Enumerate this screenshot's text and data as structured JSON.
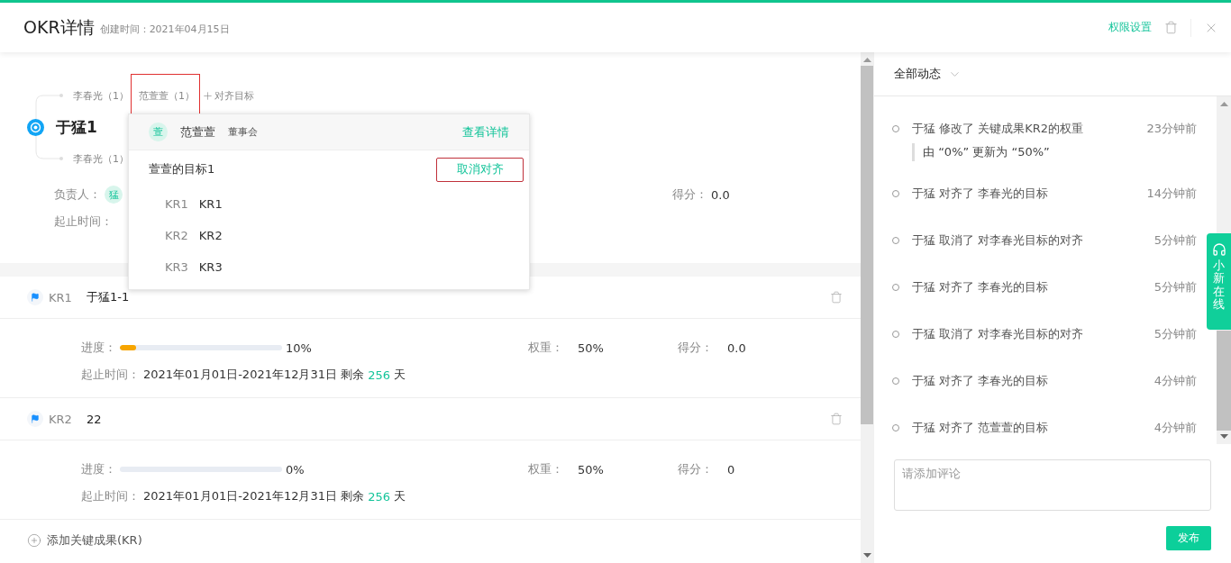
{
  "header": {
    "title": "OKR详情",
    "created": "创建时间：2021年04月15日",
    "permission_link": "权限设置"
  },
  "objective": {
    "title": "于猛1",
    "aligned_up": [
      {
        "label": "李春光（1）",
        "selected": false
      },
      {
        "label": "范萱萱（1）",
        "selected": true
      }
    ],
    "align_action": "对齐目标",
    "aligned_down": [
      {
        "label": "李春光（1）",
        "selected": false
      }
    ],
    "owner_label": "负责人：",
    "owner_avatar": "猛",
    "score_label": "得分：",
    "score": "0.0",
    "period_label": "起止时间："
  },
  "popover": {
    "avatar": "萱",
    "name": "范萱萱",
    "department": "董事会",
    "detail_link": "查看详情",
    "objective": "萱萱的目标1",
    "cancel_button": "取消对齐",
    "krs": [
      {
        "code": "KR1",
        "title": "KR1"
      },
      {
        "code": "KR2",
        "title": "KR2"
      },
      {
        "code": "KR3",
        "title": "KR3"
      }
    ]
  },
  "key_results": [
    {
      "code": "KR1",
      "title": "于猛1-1",
      "progress_label": "进度：",
      "level": 0.1,
      "progress": "10%",
      "weight_label": "权重：",
      "weight": "50%",
      "score_label": "得分：",
      "score": "0.0",
      "period_label": "起止时间：",
      "period": "2021年01月01日-2021年12月31日 剩余",
      "days": "256",
      "days_unit": "天"
    },
    {
      "code": "KR2",
      "title": "22",
      "progress_label": "进度：",
      "level": 0,
      "progress": "0%",
      "weight_label": "权重：",
      "weight": "50%",
      "score_label": "得分：",
      "score": "0",
      "period_label": "起止时间：",
      "period": "2021年01月01日-2021年12月31日 剩余",
      "days": "256",
      "days_unit": "天"
    }
  ],
  "add_kr": "添加关键成果(KR)",
  "activity": {
    "filter": "全部动态",
    "items": [
      {
        "text": "于猛 修改了 关键成果KR2的权重",
        "detail": "由 “0%” 更新为 “50%”",
        "time": "23分钟前"
      },
      {
        "text": "于猛 对齐了 李春光的目标",
        "time": "14分钟前"
      },
      {
        "text": "于猛 取消了 对李春光目标的对齐",
        "time": "5分钟前"
      },
      {
        "text": "于猛 对齐了 李春光的目标",
        "time": "5分钟前"
      },
      {
        "text": "于猛 取消了 对李春光目标的对齐",
        "time": "5分钟前"
      },
      {
        "text": "于猛 对齐了 李春光的目标",
        "time": "4分钟前"
      },
      {
        "text": "于猛 对齐了 范萱萱的目标",
        "time": "4分钟前"
      }
    ]
  },
  "comment": {
    "placeholder": "请添加评论",
    "submit": "发布"
  },
  "support_tab": "小新在线"
}
